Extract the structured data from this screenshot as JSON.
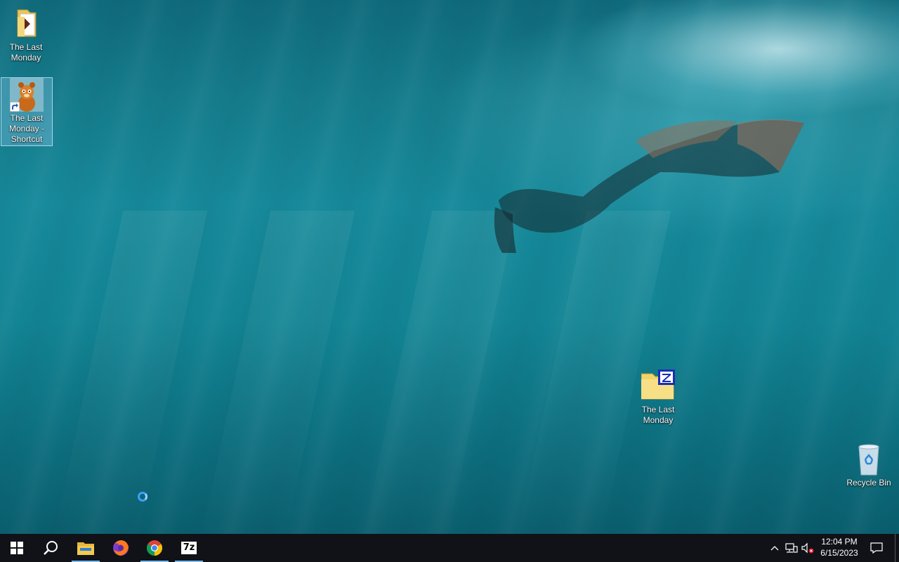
{
  "desktop": {
    "icons": [
      {
        "label": "The Last Monday",
        "type": "folder"
      },
      {
        "label": "The Last Monday - Shortcut",
        "type": "shortcut"
      },
      {
        "label": "The Last Monday",
        "type": "zip-archive"
      },
      {
        "label": "Recycle Bin",
        "type": "recycle-bin"
      }
    ]
  },
  "taskbar": {
    "apps": [
      {
        "name": "Start",
        "icon": "windows-logo-icon"
      },
      {
        "name": "Search",
        "icon": "search-icon"
      },
      {
        "name": "File Explorer",
        "icon": "folder-icon"
      },
      {
        "name": "Firefox",
        "icon": "firefox-icon"
      },
      {
        "name": "Chrome",
        "icon": "chrome-icon"
      },
      {
        "name": "7-Zip",
        "icon": "7zip-icon",
        "glyph_text": "7z"
      }
    ],
    "clock": {
      "time": "12:04 PM",
      "date": "6/15/2023"
    }
  },
  "colors": {
    "taskbar": "#101218",
    "accent": "#76b9ed",
    "water": "#16899a"
  }
}
